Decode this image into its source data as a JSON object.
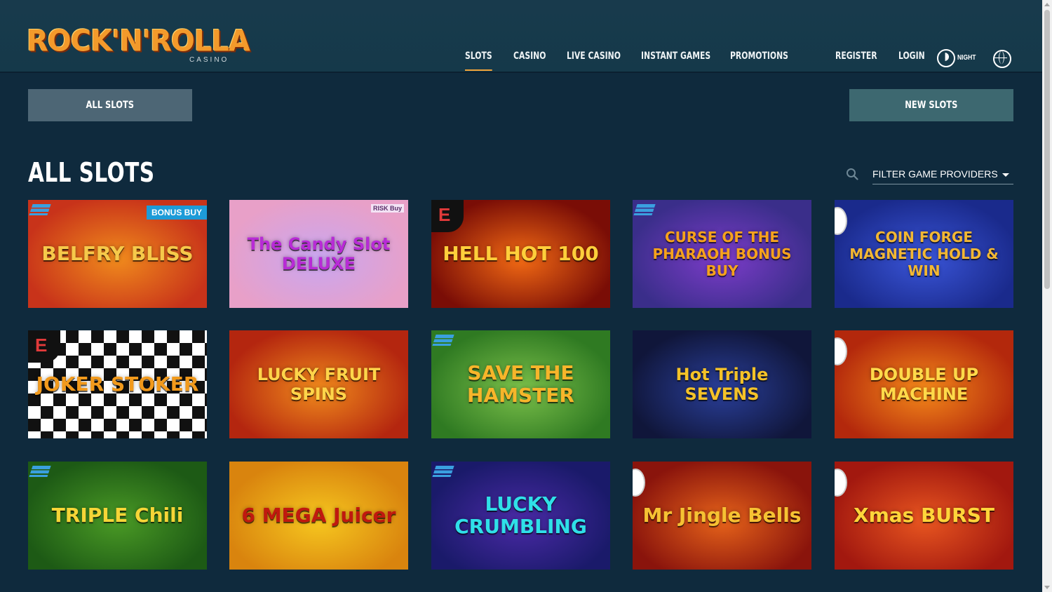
{
  "brand": {
    "logo_text": "ROCK'N'ROLLA",
    "logo_sub": "CASINO"
  },
  "nav": {
    "items": [
      {
        "label": "SLOTS",
        "active": true
      },
      {
        "label": "CASINO",
        "active": false
      },
      {
        "label": "LIVE CASINO",
        "active": false
      },
      {
        "label": "INSTANT GAMES",
        "active": false
      },
      {
        "label": "PROMOTIONS",
        "active": false
      }
    ],
    "register": "REGISTER",
    "login": "LOGIN",
    "night_label": "NIGHT"
  },
  "tabs": {
    "all_slots": "ALL SLOTS",
    "new_slots": "NEW SLOTS"
  },
  "section": {
    "title": "ALL SLOTS",
    "filter_label": "FILTER GAME PROVIDERS"
  },
  "games": [
    {
      "title": "BELFRY BLISS",
      "badge": "BONUS BUY",
      "mark": "stripes",
      "bg": "#c8331a",
      "bg2": "#f08a1c",
      "fg": "#f6c94a"
    },
    {
      "title": "The Candy Slot DELUXE",
      "corner_tag": "RISK Buy",
      "mark": "",
      "bg": "#e8a0c8",
      "bg2": "#c9a6f0",
      "fg": "#b82bd6"
    },
    {
      "title": "HELL HOT 100",
      "mark": "e",
      "bg": "#7a0d06",
      "bg2": "#f26a14",
      "fg": "#ffcf3b"
    },
    {
      "title": "CURSE OF THE PHARAOH BONUS BUY",
      "mark": "stripes",
      "bg": "#3a2e8a",
      "bg2": "#7c3cc9",
      "fg": "#f6a21c"
    },
    {
      "title": "COIN FORGE MAGNETIC HOLD & WIN",
      "mark": "round",
      "bg": "#1a2a8c",
      "bg2": "#3a55d8",
      "fg": "#f2b733"
    },
    {
      "title": "JOKER STOKER",
      "mark": "e",
      "bg": "checker",
      "bg2": "",
      "fg": "#f29a1c"
    },
    {
      "title": "LUCKY FRUIT SPINS",
      "mark": "",
      "bg": "#b4260f",
      "bg2": "#f08a1c",
      "fg": "#ffd54a"
    },
    {
      "title": "SAVE THE HAMSTER",
      "mark": "stripes",
      "bg": "#2f7a22",
      "bg2": "#7bc04a",
      "fg": "#f7b52a"
    },
    {
      "title": "Hot Triple SEVENS",
      "mark": "",
      "bg": "#10163a",
      "bg2": "#2a3f9a",
      "fg": "#f4c228"
    },
    {
      "title": "DOUBLE UP MACHINE",
      "mark": "round",
      "bg": "#b3280c",
      "bg2": "#f58a1a",
      "fg": "#ffd94a"
    },
    {
      "title": "TRIPLE Chili",
      "mark": "stripes",
      "bg": "#1d5a15",
      "bg2": "#4a9a25",
      "fg": "#f6d537"
    },
    {
      "title": "6 MEGA Juicer",
      "mark": "",
      "bg": "#d9840e",
      "bg2": "#f6c71f",
      "fg": "#c0190f"
    },
    {
      "title": "LUCKY CRUMBLING",
      "mark": "stripes",
      "bg": "#1a1a6a",
      "bg2": "#4a2aa6",
      "fg": "#2fe0e8"
    },
    {
      "title": "Mr Jingle Bells",
      "mark": "round",
      "bg": "#8a140c",
      "bg2": "#e6631a",
      "fg": "#f6c233"
    },
    {
      "title": "Xmas BURST",
      "mark": "round",
      "bg": "#a2180f",
      "bg2": "#e85620",
      "fg": "#ffd53a"
    }
  ]
}
